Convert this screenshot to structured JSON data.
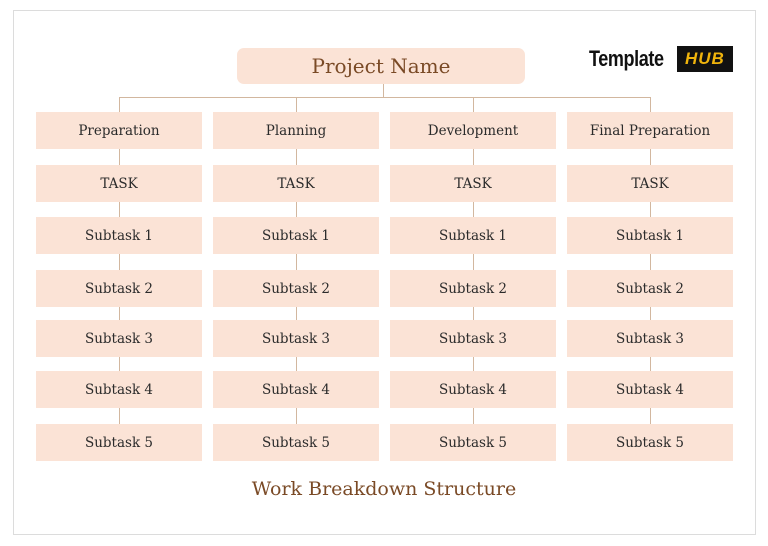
{
  "diagram": {
    "root": "Project Name",
    "footer_title": "Work Breakdown Structure",
    "logo": {
      "text": "Template",
      "badge": "HUB"
    },
    "columns": [
      {
        "header": "Preparation",
        "task": "TASK",
        "subtasks": [
          "Subtask 1",
          "Subtask 2",
          "Subtask 3",
          "Subtask 4",
          "Subtask 5"
        ]
      },
      {
        "header": "Planning",
        "task": "TASK",
        "subtasks": [
          "Subtask 1",
          "Subtask 2",
          "Subtask 3",
          "Subtask 4",
          "Subtask 5"
        ]
      },
      {
        "header": "Development",
        "task": "TASK",
        "subtasks": [
          "Subtask 1",
          "Subtask 2",
          "Subtask 3",
          "Subtask 4",
          "Subtask 5"
        ]
      },
      {
        "header": "Final Preparation",
        "task": "TASK",
        "subtasks": [
          "Subtask 1",
          "Subtask 2",
          "Subtask 3",
          "Subtask 4",
          "Subtask 5"
        ]
      }
    ],
    "colors": {
      "box_fill": "#fbe3d6",
      "connector": "#d2b79f",
      "title_text": "#7a4a26",
      "logo_badge_bg": "#111111",
      "logo_badge_text": "#f0b40c"
    }
  }
}
